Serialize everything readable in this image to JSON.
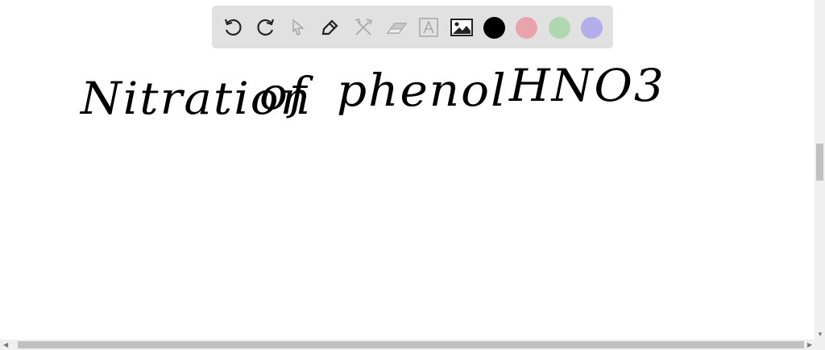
{
  "canvas": {
    "handwritten_text": [
      "Nitration",
      "of",
      "phenol",
      "HNO3"
    ]
  },
  "toolbar": {
    "tools": [
      "undo-icon",
      "redo-icon",
      "select-icon",
      "pen-icon",
      "tools-icon",
      "eraser-icon",
      "text-icon",
      "image-icon"
    ],
    "colors": [
      "#000000",
      "#e8a3ab",
      "#b0d8b0",
      "#b3aeea"
    ]
  }
}
